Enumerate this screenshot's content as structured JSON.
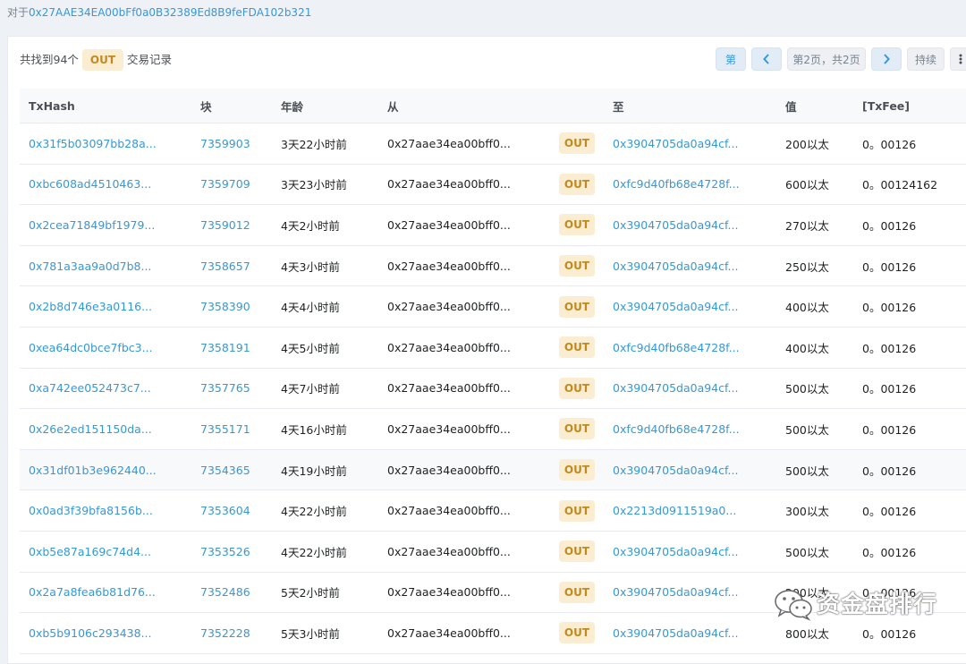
{
  "address_line": {
    "prefix": "对于",
    "address": "0x27AAE34EA00bFf0a0B32389Ed8B9feFDA102b321"
  },
  "summary": {
    "prefix": "共找到94个",
    "badge": "OUT",
    "suffix": "交易记录"
  },
  "pager": {
    "first_label": "第",
    "page_text": "第2页，共2页",
    "last_label": "持续",
    "prev_icon": "chevron-left-icon",
    "next_icon": "chevron-right-icon",
    "more_icon": "more-vertical-icon"
  },
  "table": {
    "columns": [
      "TxHash",
      "块",
      "年龄",
      "从",
      "",
      "至",
      "值",
      "[TxFee]"
    ],
    "rows": [
      {
        "hash": "0x31f5b03097bb28a...",
        "block": "7359903",
        "age": "3天22小时前",
        "from": "0x27aae34ea00bff0...",
        "dir": "OUT",
        "to": "0x3904705da0a94cf...",
        "value": "200以太",
        "fee": "0。00126"
      },
      {
        "hash": "0xbc608ad4510463...",
        "block": "7359709",
        "age": "3天23小时前",
        "from": "0x27aae34ea00bff0...",
        "dir": "OUT",
        "to": "0xfc9d40fb68e4728f...",
        "value": "600以太",
        "fee": "0。00124162"
      },
      {
        "hash": "0x2cea71849bf1979...",
        "block": "7359012",
        "age": "4天2小时前",
        "from": "0x27aae34ea00bff0...",
        "dir": "OUT",
        "to": "0x3904705da0a94cf...",
        "value": "270以太",
        "fee": "0。00126"
      },
      {
        "hash": "0x781a3aa9a0d7b8...",
        "block": "7358657",
        "age": "4天3小时前",
        "from": "0x27aae34ea00bff0...",
        "dir": "OUT",
        "to": "0x3904705da0a94cf...",
        "value": "250以太",
        "fee": "0。00126"
      },
      {
        "hash": "0x2b8d746e3a0116...",
        "block": "7358390",
        "age": "4天4小时前",
        "from": "0x27aae34ea00bff0...",
        "dir": "OUT",
        "to": "0x3904705da0a94cf...",
        "value": "400以太",
        "fee": "0。00126"
      },
      {
        "hash": "0xea64dc0bce7fbc3...",
        "block": "7358191",
        "age": "4天5小时前",
        "from": "0x27aae34ea00bff0...",
        "dir": "OUT",
        "to": "0xfc9d40fb68e4728f...",
        "value": "400以太",
        "fee": "0。00126"
      },
      {
        "hash": "0xa742ee052473c7...",
        "block": "7357765",
        "age": "4天7小时前",
        "from": "0x27aae34ea00bff0...",
        "dir": "OUT",
        "to": "0x3904705da0a94cf...",
        "value": "500以太",
        "fee": "0。00126"
      },
      {
        "hash": "0x26e2ed151150da...",
        "block": "7355171",
        "age": "4天16小时前",
        "from": "0x27aae34ea00bff0...",
        "dir": "OUT",
        "to": "0xfc9d40fb68e4728f...",
        "value": "500以太",
        "fee": "0。00126"
      },
      {
        "hash": "0x31df01b3e962440...",
        "block": "7354365",
        "age": "4天19小时前",
        "from": "0x27aae34ea00bff0...",
        "dir": "OUT",
        "to": "0x3904705da0a94cf...",
        "value": "500以太",
        "fee": "0。00126"
      },
      {
        "hash": "0x0ad3f39bfa8156b...",
        "block": "7353604",
        "age": "4天22小时前",
        "from": "0x27aae34ea00bff0...",
        "dir": "OUT",
        "to": "0x2213d0911519a0...",
        "value": "300以太",
        "fee": "0。00126"
      },
      {
        "hash": "0xb5e87a169c74d4...",
        "block": "7353526",
        "age": "4天22小时前",
        "from": "0x27aae34ea00bff0...",
        "dir": "OUT",
        "to": "0x3904705da0a94cf...",
        "value": "500以太",
        "fee": "0。00126"
      },
      {
        "hash": "0x2a7a8fea6b81d76...",
        "block": "7352486",
        "age": "5天2小时前",
        "from": "0x27aae34ea00bff0...",
        "dir": "OUT",
        "to": "0x3904705da0a94cf...",
        "value": "200以太",
        "fee": "0。00126"
      },
      {
        "hash": "0xb5b9106c293438...",
        "block": "7352228",
        "age": "5天3小时前",
        "from": "0x27aae34ea00bff0...",
        "dir": "OUT",
        "to": "0x3904705da0a94cf...",
        "value": "800以太",
        "fee": "0。00126"
      }
    ]
  },
  "watermark": {
    "text": "资金盘排行",
    "icon": "wechat-icon"
  },
  "colors": {
    "link": "#3498db",
    "badge_bg": "#fbedd1",
    "badge_text": "#c28a1e",
    "pager_bg": "#e2ecf7"
  }
}
